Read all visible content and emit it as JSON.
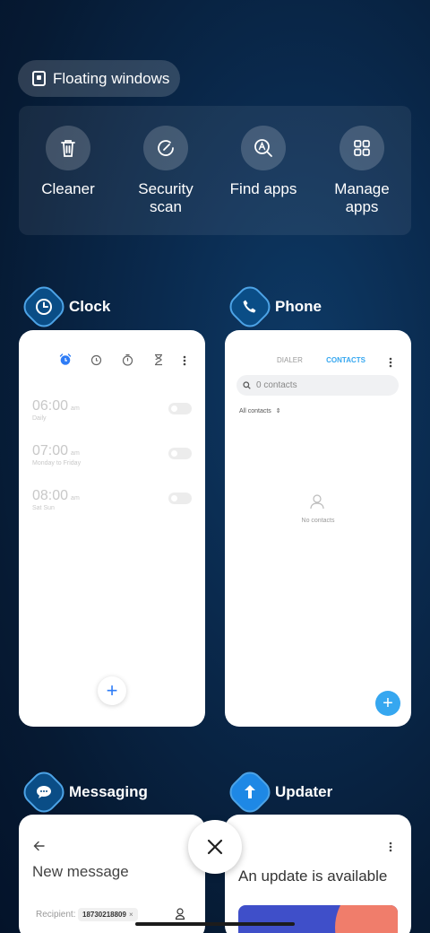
{
  "floating": {
    "label": "Floating windows"
  },
  "quick_actions": [
    {
      "label": "Cleaner",
      "icon": "trash-icon"
    },
    {
      "label": "Security\nscan",
      "icon": "security-scan-icon"
    },
    {
      "label": "Find apps",
      "icon": "find-apps-icon"
    },
    {
      "label": "Manage\napps",
      "icon": "grid-icon"
    }
  ],
  "apps": {
    "clock": {
      "title": "Clock",
      "alarms": [
        {
          "time": "06:00",
          "ampm": "am",
          "days": "Daily"
        },
        {
          "time": "07:00",
          "ampm": "am",
          "days": "Monday to Friday"
        },
        {
          "time": "08:00",
          "ampm": "am",
          "days": "Sat Sun"
        }
      ],
      "fab": "+"
    },
    "phone": {
      "title": "Phone",
      "tab_dialer": "DIALER",
      "tab_contacts": "CONTACTS",
      "search_placeholder": "0 contacts",
      "filter": "All contacts",
      "empty": "No contacts",
      "fab": "+"
    },
    "messaging": {
      "title": "Messaging",
      "header": "New message",
      "recipient_label": "Recipient:",
      "recipient_value": "18730218809"
    },
    "updater": {
      "title": "Updater",
      "headline": "An update is available"
    }
  },
  "colors": {
    "accent": "#2e7cf6",
    "tab_active": "#36a7f0",
    "fab": "#36a7f0"
  }
}
